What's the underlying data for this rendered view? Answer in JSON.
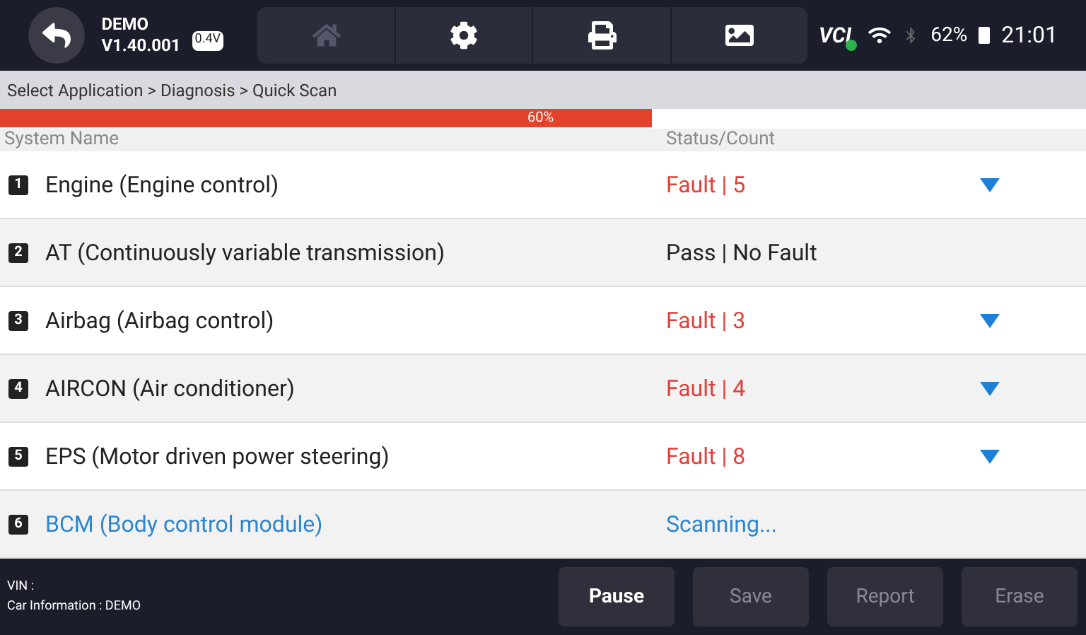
{
  "header": {
    "app_name": "DEMO",
    "version": "V1.40.001",
    "battery_voltage": "0.4V",
    "toolbar": [
      {
        "kind": "home",
        "disabled": true
      },
      {
        "kind": "settings",
        "disabled": false
      },
      {
        "kind": "print",
        "disabled": false
      },
      {
        "kind": "image",
        "disabled": false
      }
    ],
    "vci_label": "VCI",
    "battery_percent": "62%",
    "time": "21:01"
  },
  "breadcrumb": "Select Application > Diagnosis > Quick Scan",
  "progress": {
    "level": 0.6,
    "label": "60%"
  },
  "table": {
    "columns": [
      "System Name",
      "Status/Count"
    ],
    "rows": [
      {
        "index": "1",
        "name": "Engine (Engine control)",
        "status": "Fault | 5",
        "kind": "fault",
        "expandable": true
      },
      {
        "index": "2",
        "name": "AT (Continuously variable transmission)",
        "status": "Pass | No Fault",
        "kind": "pass",
        "expandable": false
      },
      {
        "index": "3",
        "name": "Airbag (Airbag control)",
        "status": "Fault | 3",
        "kind": "fault",
        "expandable": true
      },
      {
        "index": "4",
        "name": "AIRCON (Air conditioner)",
        "status": "Fault | 4",
        "kind": "fault",
        "expandable": true
      },
      {
        "index": "5",
        "name": "EPS (Motor driven power steering)",
        "status": "Fault | 8",
        "kind": "fault",
        "expandable": true
      },
      {
        "index": "6",
        "name": "BCM (Body control module)",
        "status": "Scanning...",
        "kind": "scanning",
        "expandable": false
      }
    ]
  },
  "footer": {
    "vin": "VIN :",
    "car_info": "Car Information : DEMO",
    "buttons": [
      {
        "label": "Pause",
        "disabled": false
      },
      {
        "label": "Save",
        "disabled": true
      },
      {
        "label": "Report",
        "disabled": true
      },
      {
        "label": "Erase",
        "disabled": true
      }
    ]
  }
}
